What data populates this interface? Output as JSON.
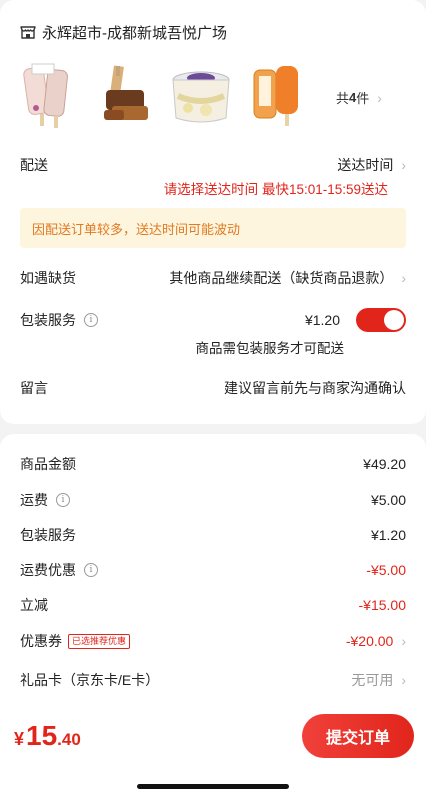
{
  "store": {
    "name": "永辉超市-成都新城吾悦广场",
    "icon": "store-icon"
  },
  "products": [
    {
      "name": "bar-ice-cream-pink"
    },
    {
      "name": "chocolate-ice-cream-bar"
    },
    {
      "name": "ice-cream-cup"
    },
    {
      "name": "orange-popsicle"
    }
  ],
  "product_count": {
    "prefix": "共",
    "num": "4",
    "suffix": "件"
  },
  "delivery": {
    "label": "配送",
    "value": "送达时间",
    "sub": "请选择送达时间  最快15:01-15:59送达"
  },
  "notice": "因配送订单较多，送达时间可能波动",
  "out_of_stock": {
    "label": "如遇缺货",
    "value": "其他商品继续配送（缺货商品退款）"
  },
  "packaging": {
    "label": "包装服务",
    "price": "¥1.20",
    "note": "商品需包装服务才可配送",
    "enabled": true
  },
  "message": {
    "label": "留言",
    "placeholder": "建议留言前先与商家沟通确认"
  },
  "summary": [
    {
      "label": "商品金额",
      "value": "¥49.20",
      "red": false
    },
    {
      "label": "运费",
      "value": "¥5.00",
      "info": true
    },
    {
      "label": "包装服务",
      "value": "¥1.20"
    },
    {
      "label": "运费优惠",
      "value": "-¥5.00",
      "info": true,
      "red": true
    },
    {
      "label": "立减",
      "value": "-¥15.00",
      "red": true
    },
    {
      "label": "优惠券",
      "badge": "已选推荐优惠",
      "value": "-¥20.00",
      "red": true
    },
    {
      "label": "礼品卡（京东卡/E卡）",
      "value": "无可用",
      "grey": true
    }
  ],
  "footer": {
    "currency": "¥",
    "total_int": "15",
    "total_dec": ".40",
    "submit_label": "提交订单"
  },
  "colors": {
    "accent": "#e1251b",
    "notice_bg": "#fdf5de",
    "notice_text": "#e07a22"
  }
}
